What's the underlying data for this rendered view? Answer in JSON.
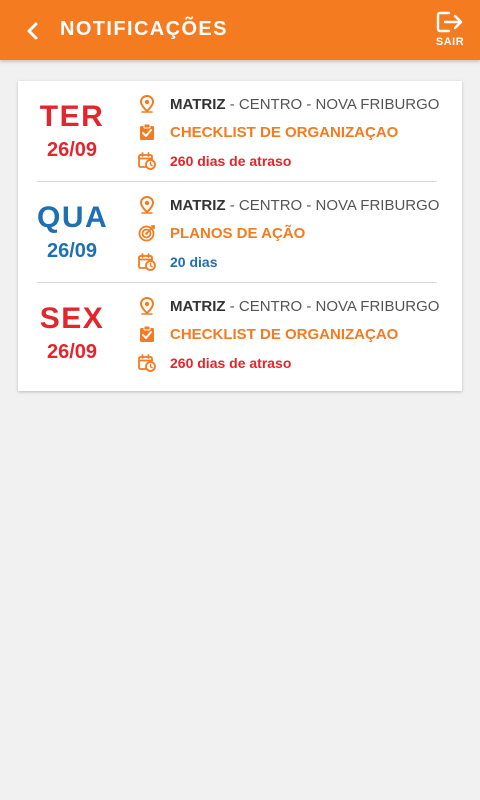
{
  "header": {
    "title": "NOTIFICAÇÕES",
    "exit_label": "SAIR",
    "bg_color": "#f47b20"
  },
  "colors": {
    "red": "#e3262b",
    "blue": "#1f6fb5",
    "orange": "#f47b20"
  },
  "notifications": [
    {
      "day": "TER",
      "date": "26/09",
      "location_bold": "MATRIZ",
      "location_rest": " - CENTRO - NOVA FRIBURGO",
      "task": "CHECKLIST DE ORGANIZAÇAO",
      "task_icon": "clipboard-check-icon",
      "delay": "260 dias de atraso",
      "status": "overdue",
      "color": "#e3262b"
    },
    {
      "day": "QUA",
      "date": "26/09",
      "location_bold": "MATRIZ",
      "location_rest": " - CENTRO - NOVA FRIBURGO",
      "task": "PLANOS DE AÇÃO",
      "task_icon": "target-icon",
      "delay": "20 dias",
      "status": "pending",
      "color": "#1f6fb5"
    },
    {
      "day": "SEX",
      "date": "26/09",
      "location_bold": "MATRIZ",
      "location_rest": " - CENTRO - NOVA FRIBURGO",
      "task": "CHECKLIST DE ORGANIZAÇAO",
      "task_icon": "clipboard-check-icon",
      "delay": "260 dias de atraso",
      "status": "overdue",
      "color": "#e3262b"
    }
  ]
}
